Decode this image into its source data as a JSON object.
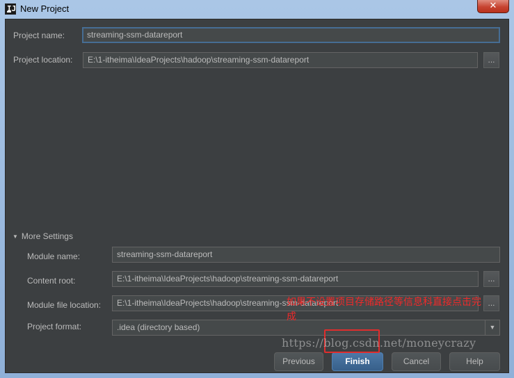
{
  "window": {
    "title": "New Project",
    "close_glyph": "✕"
  },
  "form": {
    "project_name_label": "Project name:",
    "project_name_value": "streaming-ssm-datareport",
    "project_location_label": "Project location:",
    "project_location_value": "E:\\1-itheima\\IdeaProjects\\hadoop\\streaming-ssm-datareport",
    "browse_label": "..."
  },
  "more_settings": {
    "toggle_label": "More Settings",
    "module_name_label": "Module name:",
    "module_name_value": "streaming-ssm-datareport",
    "content_root_label": "Content root:",
    "content_root_value": "E:\\1-itheima\\IdeaProjects\\hadoop\\streaming-ssm-datareport",
    "module_file_label": "Module file location:",
    "module_file_value": "E:\\1-itheima\\IdeaProjects\\hadoop\\streaming-ssm-datareport",
    "project_format_label": "Project format:",
    "project_format_value": ".idea (directory based)"
  },
  "buttons": {
    "previous": "Previous",
    "finish": "Finish",
    "cancel": "Cancel",
    "help": "Help"
  },
  "annotation": {
    "text": "如果不设置项目存储路径等信息科直接点击完成",
    "color": "#f02a2a"
  },
  "watermark": "https://blog.csdn.net/moneycrazy"
}
